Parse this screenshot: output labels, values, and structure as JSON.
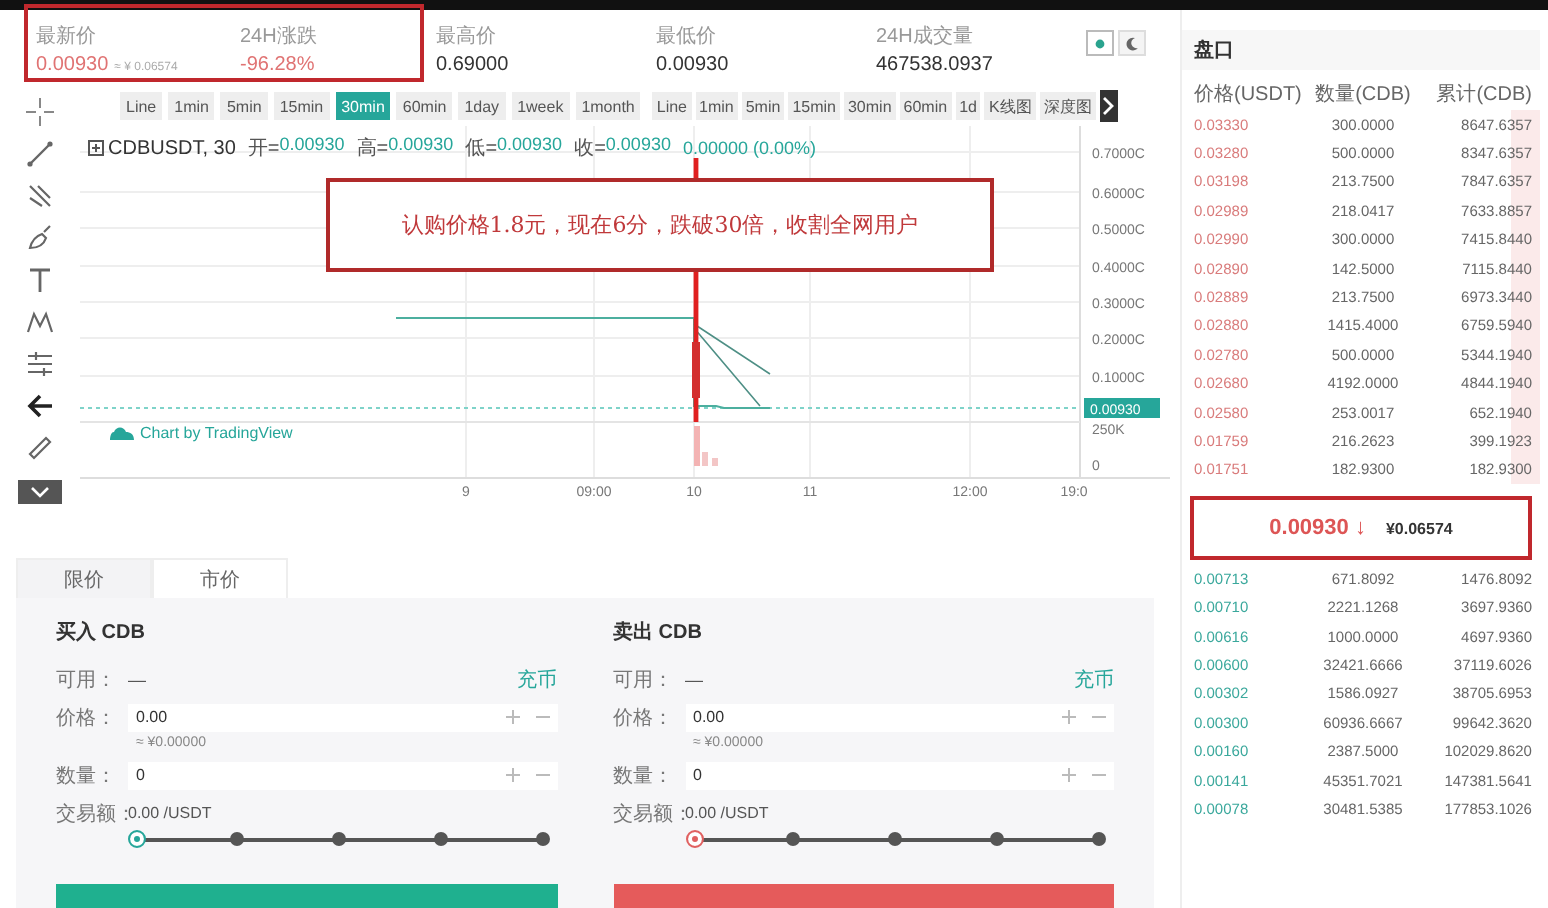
{
  "stats": [
    {
      "label": "最新价",
      "value": "0.00930",
      "sub": "≈ ¥ 0.06574",
      "color": "#e07373",
      "highlighted": true
    },
    {
      "label": "24H涨跌",
      "value": "-96.28%",
      "color": "#e07373",
      "highlighted": true
    },
    {
      "label": "最高价",
      "value": "0.69000",
      "color": "#333333"
    },
    {
      "label": "最低价",
      "value": "0.00930",
      "color": "#333333"
    },
    {
      "label": "24H成交量",
      "value": "467538.0937",
      "color": "#333333"
    }
  ],
  "theme_toggle": [
    {
      "kind": "light",
      "selected": true
    },
    {
      "kind": "dark",
      "selected": false
    }
  ],
  "toolbar": {
    "left": [
      {
        "label": "Line",
        "selected": false
      },
      {
        "label": "1min",
        "selected": false
      },
      {
        "label": "5min",
        "selected": false
      },
      {
        "label": "15min",
        "selected": false
      },
      {
        "label": "30min",
        "selected": true
      },
      {
        "label": "60min",
        "selected": false
      },
      {
        "label": "1day",
        "selected": false
      },
      {
        "label": "1week",
        "selected": false
      },
      {
        "label": "1month",
        "selected": false
      }
    ],
    "right": [
      {
        "label": "Line",
        "selected": false
      },
      {
        "label": "1min",
        "selected": false
      },
      {
        "label": "5min",
        "selected": false
      },
      {
        "label": "15min",
        "selected": false
      },
      {
        "label": "30min",
        "selected": false
      },
      {
        "label": "60min",
        "selected": false
      },
      {
        "label": "1d",
        "selected": false
      },
      {
        "label": "K线图",
        "selected": false
      },
      {
        "label": "深度图",
        "selected": false
      }
    ]
  },
  "chart": {
    "symbol": "CDBUSDT, 30",
    "ohlc": [
      {
        "label": "开=",
        "value": "0.00930"
      },
      {
        "label": "高=",
        "value": "0.00930"
      },
      {
        "label": "低=",
        "value": "0.00930"
      },
      {
        "label": "收=",
        "value": "0.00930"
      }
    ],
    "change": "0.00000 (0.00%)",
    "y_labels": [
      "0.7000C",
      "0.6000C",
      "0.5000C",
      "0.4000C",
      "0.3000C",
      "0.2000C",
      "0.1000C"
    ],
    "last_price_tag": "0.00930",
    "volume_labels": [
      "250K",
      "0"
    ],
    "x_labels": [
      "9",
      "09:00",
      "10",
      "11",
      "12:00",
      "19:0"
    ],
    "credit": "Chart by TradingView",
    "note": "认购价格1.8元，现在6分，跌破30倍，收割全网用户"
  },
  "order_tabs": [
    {
      "label": "限价",
      "selected": false
    },
    {
      "label": "市价",
      "selected": true
    }
  ],
  "forms": [
    {
      "kind": "buy",
      "title": "买入 CDB",
      "available_label": "可用：",
      "available": "—",
      "deposit": "充币",
      "price_label": "价格：",
      "price": "0.00",
      "price_cny": "≈ ¥0.00000",
      "amount_label": "数量：",
      "amount": "0",
      "total_label": "交易额：",
      "total": "0.00 /USDT",
      "level": 0
    },
    {
      "kind": "sell",
      "title": "卖出 CDB",
      "available_label": "可用：",
      "available": "—",
      "deposit": "充币",
      "price_label": "价格：",
      "price": "0.00",
      "price_cny": "≈ ¥0.00000",
      "amount_label": "数量：",
      "amount": "0",
      "total_label": "交易额：",
      "total": "0.00 /USDT",
      "level": 0
    }
  ],
  "orderbook": {
    "title": "盘口",
    "columns": [
      "价格(USDT)",
      "数量(CDB)",
      "累计(CDB)"
    ],
    "asks": [
      [
        "0.03330",
        "300.0000",
        "8647.6357"
      ],
      [
        "0.03280",
        "500.0000",
        "8347.6357"
      ],
      [
        "0.03198",
        "213.7500",
        "7847.6357"
      ],
      [
        "0.02989",
        "218.0417",
        "7633.8857"
      ],
      [
        "0.02990",
        "300.0000",
        "7415.8440"
      ],
      [
        "0.02890",
        "142.5000",
        "7115.8440"
      ],
      [
        "0.02889",
        "213.7500",
        "6973.3440"
      ],
      [
        "0.02880",
        "1415.4000",
        "6759.5940"
      ],
      [
        "0.02780",
        "500.0000",
        "5344.1940"
      ],
      [
        "0.02680",
        "4192.0000",
        "4844.1940"
      ],
      [
        "0.02580",
        "253.0017",
        "652.1940"
      ],
      [
        "0.01759",
        "216.2623",
        "399.1923"
      ],
      [
        "0.01751",
        "182.9300",
        "182.9300"
      ]
    ],
    "last": {
      "price": "0.00930",
      "arrow": "↓",
      "cny": "¥0.06574",
      "highlighted": true
    },
    "bids": [
      [
        "0.00713",
        "671.8092",
        "1476.8092"
      ],
      [
        "0.00710",
        "2221.1268",
        "3697.9360"
      ],
      [
        "0.00616",
        "1000.0000",
        "4697.9360"
      ],
      [
        "0.00600",
        "32421.6666",
        "37119.6026"
      ],
      [
        "0.00302",
        "1586.0927",
        "38705.6953"
      ],
      [
        "0.00300",
        "60936.6667",
        "99642.3620"
      ],
      [
        "0.00160",
        "2387.5000",
        "102029.8620"
      ],
      [
        "0.00141",
        "45351.7021",
        "147381.5641"
      ],
      [
        "0.00078",
        "30481.5385",
        "177853.1026"
      ]
    ]
  }
}
